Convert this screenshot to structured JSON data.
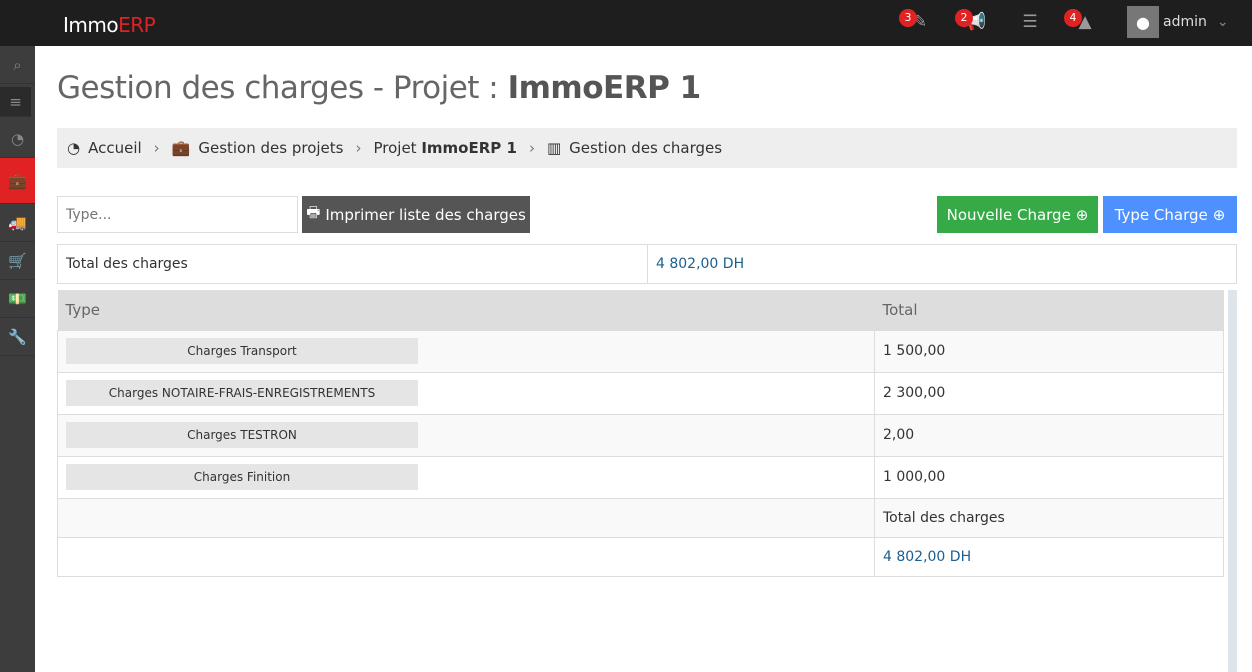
{
  "app": {
    "logo_main": "Immo",
    "logo_accent": "ERP"
  },
  "topbar": {
    "tasks_badge": "3",
    "announce_badge": "2",
    "alerts_badge": "4",
    "user": "admin"
  },
  "page": {
    "title_prefix": "Gestion des charges - Projet : ",
    "title_project": "ImmoERP 1"
  },
  "breadcrumb": {
    "home": "Accueil",
    "projects": "Gestion des projets",
    "project_prefix": "Projet ",
    "project_name": "ImmoERP 1",
    "current": "Gestion des charges"
  },
  "toolbar": {
    "search_placeholder": "Type...",
    "print": "Imprimer liste des charges",
    "new_charge": "Nouvelle Charge",
    "type_charge": "Type Charge"
  },
  "summary": {
    "label": "Total des charges",
    "value": "4 802,00 DH"
  },
  "table": {
    "headers": [
      "Type",
      "Total"
    ],
    "rows": [
      {
        "type": "Charges Transport",
        "total": "1 500,00"
      },
      {
        "type": "Charges NOTAIRE-FRAIS-ENREGISTREMENTS",
        "total": "2 300,00"
      },
      {
        "type": "Charges TESTRON",
        "total": "2,00"
      },
      {
        "type": "Charges Finition",
        "total": "1 000,00"
      }
    ],
    "footer_label": "Total des charges",
    "footer_value": "4 802,00 DH"
  },
  "colors": {
    "accent": "#e02222",
    "green": "#35aa47",
    "blue": "#4d90fe",
    "dark": "#555555"
  }
}
